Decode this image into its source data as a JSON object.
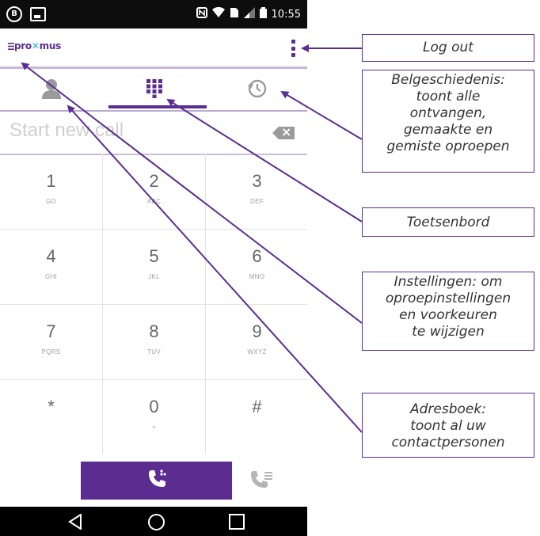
{
  "status_bar": {
    "time": "10:55",
    "left_icons": [
      "circle-b-icon",
      "image-icon"
    ],
    "right_icons": [
      "nfc-icon",
      "wifi-icon",
      "sim-icon",
      "signal-icon",
      "battery-icon"
    ]
  },
  "app": {
    "brand_prefix": "pro",
    "brand_x": "✕",
    "brand_suffix": "mus",
    "menu_icon": "overflow-menu-icon"
  },
  "tabs": [
    {
      "icon": "contacts-icon"
    },
    {
      "icon": "dialpad-icon",
      "selected": true
    },
    {
      "icon": "history-icon"
    }
  ],
  "input": {
    "placeholder": "Start new call"
  },
  "keypad": [
    {
      "digit": "1",
      "letters": "GO"
    },
    {
      "digit": "2",
      "letters": "ABC"
    },
    {
      "digit": "3",
      "letters": "DEF"
    },
    {
      "digit": "4",
      "letters": "GHI"
    },
    {
      "digit": "5",
      "letters": "JKL"
    },
    {
      "digit": "6",
      "letters": "MNO"
    },
    {
      "digit": "7",
      "letters": "PQRS"
    },
    {
      "digit": "8",
      "letters": "TUV"
    },
    {
      "digit": "9",
      "letters": "WXYZ"
    },
    {
      "digit": "*",
      "letters": ""
    },
    {
      "digit": "0",
      "letters": "+"
    },
    {
      "digit": "#",
      "letters": ""
    }
  ],
  "callouts": {
    "logout": [
      "Log out"
    ],
    "history": [
      "Belgeschiedenis:",
      "toont alle",
      "ontvangen,",
      "gemaakte en",
      "gemiste oproepen"
    ],
    "toetsenbord": [
      "Toetsenbord"
    ],
    "instellingen": [
      "Instellingen: om",
      "oproepinstellingen",
      "en voorkeuren",
      "te wijzigen"
    ],
    "adresboek": [
      "Adresboek:",
      "toont al uw",
      "contactpersonen"
    ]
  },
  "colors": {
    "accent": "#5c2d91",
    "brand_x": "#2aa7df"
  }
}
